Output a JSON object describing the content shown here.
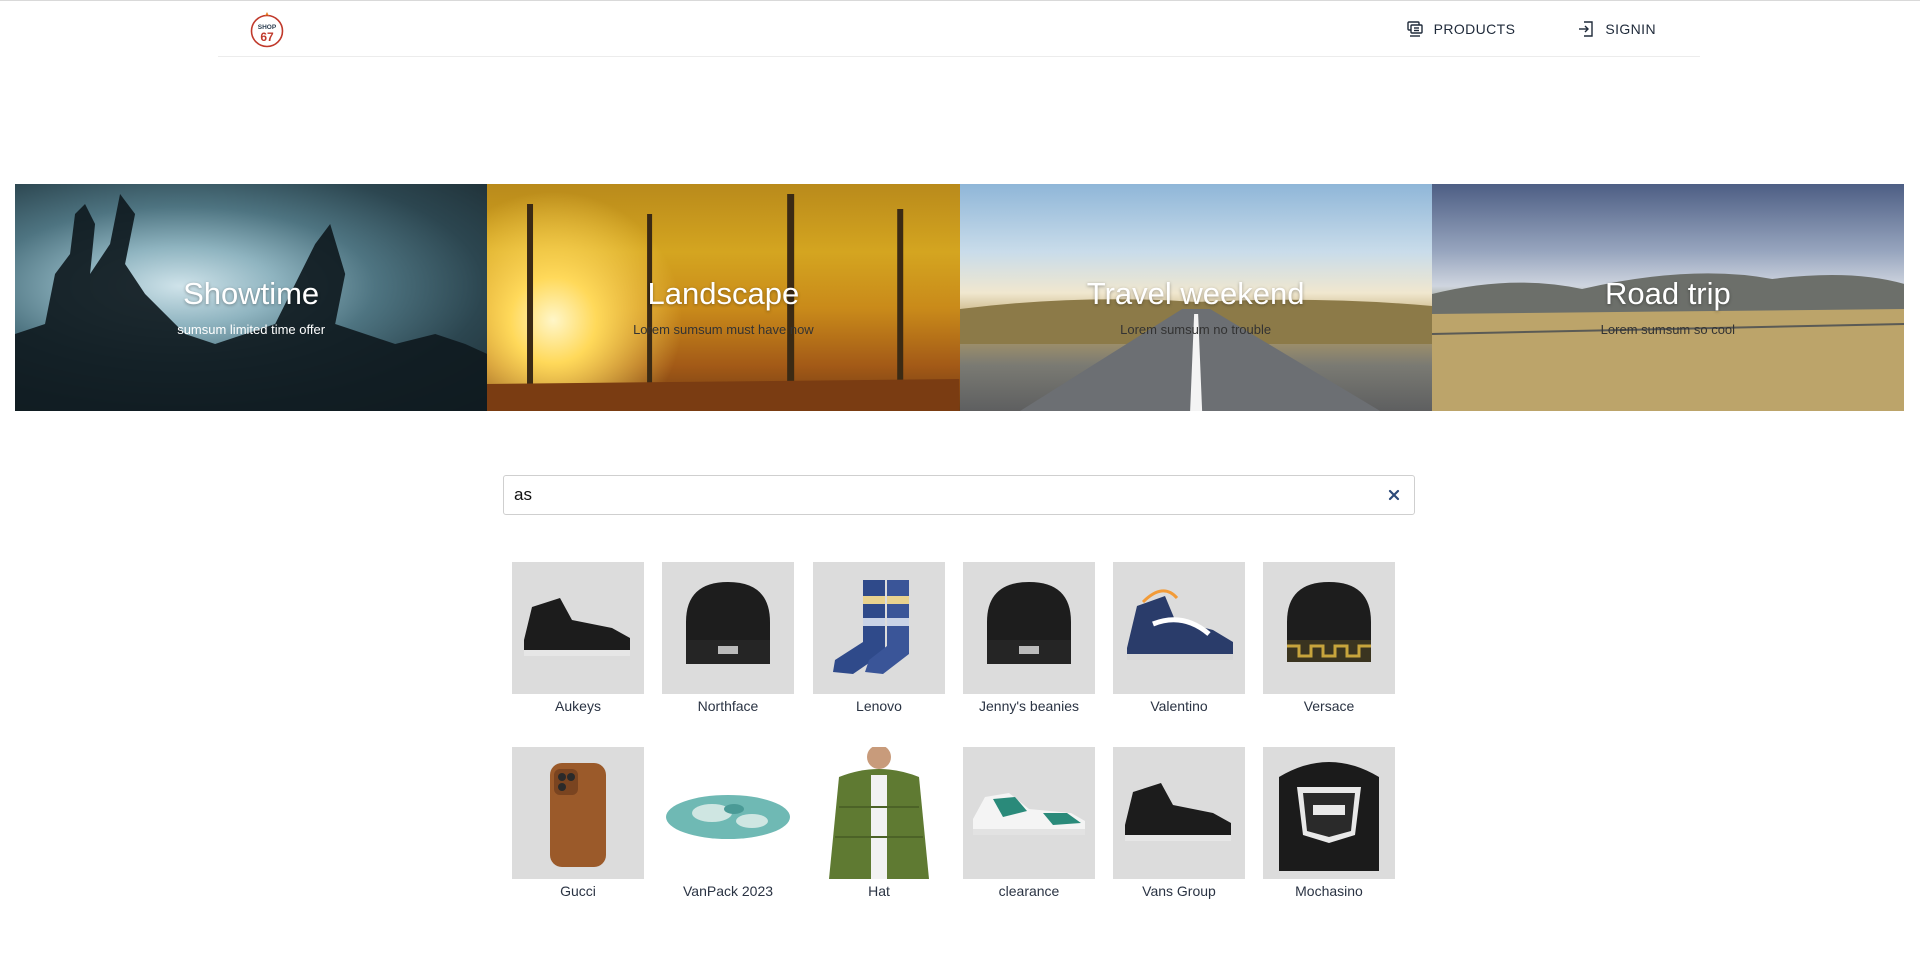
{
  "header": {
    "logo_text": "SHOP 67",
    "nav": [
      {
        "label": "PRODUCTS",
        "icon": "products-icon"
      },
      {
        "label": "SIGNIN",
        "icon": "signin-icon"
      }
    ]
  },
  "banners": [
    {
      "title": "Showtime",
      "subtitle": "sumsum limited time offer"
    },
    {
      "title": "Landscape",
      "subtitle": "Lorem sumsum must have now"
    },
    {
      "title": "Travel weekend",
      "subtitle": "Lorem sumsum no trouble"
    },
    {
      "title": "Road trip",
      "subtitle": "Lorem sumsum so cool"
    }
  ],
  "search": {
    "value": "as",
    "clear_icon": "close-icon"
  },
  "products": [
    {
      "name": "Aukeys",
      "image": "sneaker-icon"
    },
    {
      "name": "Northface",
      "image": "beanie-icon"
    },
    {
      "name": "Lenovo",
      "image": "socks-icon"
    },
    {
      "name": "Jenny's beanies",
      "image": "beanie-icon"
    },
    {
      "name": "Valentino",
      "image": "sneaker-icon"
    },
    {
      "name": "Versace",
      "image": "beanie-icon"
    },
    {
      "name": "Gucci",
      "image": "phone-case-icon"
    },
    {
      "name": "VanPack 2023",
      "image": "shoe-sole-icon"
    },
    {
      "name": "Hat",
      "image": "jacket-icon"
    },
    {
      "name": "clearance",
      "image": "sneaker-icon"
    },
    {
      "name": "Vans Group",
      "image": "sneaker-icon"
    },
    {
      "name": "Mochasino",
      "image": "backpack-icon"
    }
  ]
}
